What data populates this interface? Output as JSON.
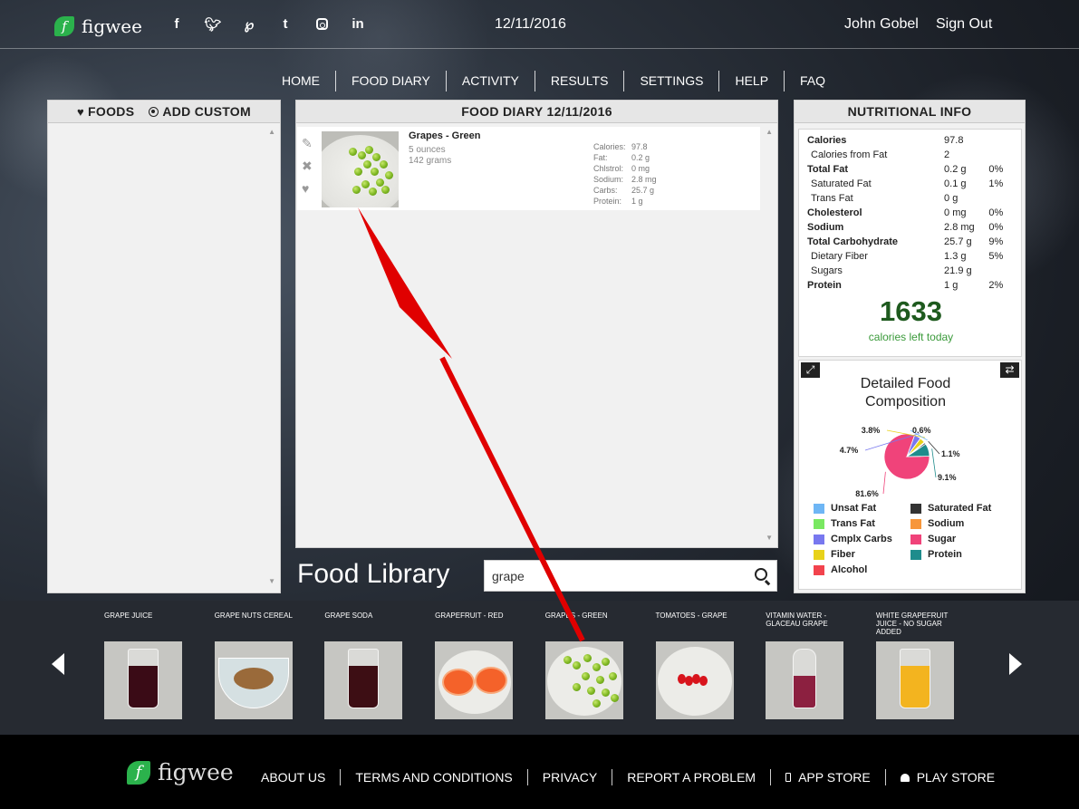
{
  "header": {
    "brand": "figwee",
    "date": "12/11/2016",
    "user_name": "John Gobel",
    "sign_out": "Sign Out",
    "social_icons": [
      "facebook-icon",
      "twitter-icon",
      "pinterest-icon",
      "tumblr-icon",
      "instagram-icon",
      "linkedin-icon"
    ]
  },
  "nav": [
    "HOME",
    "FOOD DIARY",
    "ACTIVITY",
    "RESULTS",
    "SETTINGS",
    "HELP",
    "FAQ"
  ],
  "foods_panel": {
    "tab_foods": "FOODS",
    "tab_custom": "ADD CUSTOM"
  },
  "diary": {
    "title": "FOOD DIARY 12/11/2016",
    "entry": {
      "name": "Grapes - Green",
      "qty_oz": "5 ounces",
      "qty_g": "142 grams",
      "nutrients": [
        {
          "k": "Calories:",
          "v": "97.8"
        },
        {
          "k": "Fat:",
          "v": "0.2 g"
        },
        {
          "k": "Chlstrol:",
          "v": "0 mg"
        },
        {
          "k": "Sodium:",
          "v": "2.8 mg"
        },
        {
          "k": "Carbs:",
          "v": "25.7 g"
        },
        {
          "k": "Protein:",
          "v": "1 g"
        }
      ]
    }
  },
  "nutrition": {
    "title": "NUTRITIONAL INFO",
    "rows": [
      {
        "label": "Calories",
        "amount": "97.8",
        "pct": "",
        "style": "bold"
      },
      {
        "label": "Calories from Fat",
        "amount": "2",
        "pct": "",
        "style": "sub"
      },
      {
        "label": "Total Fat",
        "amount": "0.2 g",
        "pct": "0%",
        "style": "bold"
      },
      {
        "label": "Saturated Fat",
        "amount": "0.1 g",
        "pct": "1%",
        "style": "sub"
      },
      {
        "label": "Trans Fat",
        "amount": "0 g",
        "pct": "",
        "style": "sub"
      },
      {
        "label": "Cholesterol",
        "amount": "0 mg",
        "pct": "0%",
        "style": "bold"
      },
      {
        "label": "Sodium",
        "amount": "2.8 mg",
        "pct": "0%",
        "style": "bold"
      },
      {
        "label": "Total Carbohydrate",
        "amount": "25.7 g",
        "pct": "9%",
        "style": "bold"
      },
      {
        "label": "Dietary Fiber",
        "amount": "1.3 g",
        "pct": "5%",
        "style": "sub"
      },
      {
        "label": "Sugars",
        "amount": "21.9 g",
        "pct": "",
        "style": "sub"
      },
      {
        "label": "Protein",
        "amount": "1 g",
        "pct": "2%",
        "style": "bold"
      }
    ],
    "calories_left": "1633",
    "calories_left_label": "calories left today"
  },
  "composition": {
    "title_line1": "Detailed Food",
    "title_line2": "Composition",
    "legend": [
      {
        "name": "Unsat Fat",
        "color": "#6eb6f5"
      },
      {
        "name": "Saturated Fat",
        "color": "#333333"
      },
      {
        "name": "Trans Fat",
        "color": "#79e861"
      },
      {
        "name": "Sodium",
        "color": "#f7963a"
      },
      {
        "name": "Cmplx Carbs",
        "color": "#7878ef"
      },
      {
        "name": "Sugar",
        "color": "#f0437a"
      },
      {
        "name": "Fiber",
        "color": "#e8d21a"
      },
      {
        "name": "Protein",
        "color": "#1e8c8c"
      },
      {
        "name": "Alcohol",
        "color": "#f2434d"
      }
    ]
  },
  "chart_data": {
    "type": "pie",
    "title": "Detailed Food Composition",
    "slices": [
      {
        "name": "Sugar",
        "value": 81.6,
        "label": "81.6%",
        "color": "#f0437a"
      },
      {
        "name": "Cmplx Carbs",
        "value": 4.7,
        "label": "4.7%",
        "color": "#7878ef"
      },
      {
        "name": "Fiber",
        "value": 3.8,
        "label": "3.8%",
        "color": "#e8d21a"
      },
      {
        "name": "Unsat Fat",
        "value": 0.6,
        "label": "0.6%",
        "color": "#6eb6f5"
      },
      {
        "name": "Saturated Fat",
        "value": 1.1,
        "label": "1.1%",
        "color": "#333333"
      },
      {
        "name": "Protein",
        "value": 9.1,
        "label": "9.1%",
        "color": "#1e8c8c"
      }
    ]
  },
  "library": {
    "title": "Food Library",
    "search_value": "grape",
    "items": [
      {
        "name": "GRAPE JUICE",
        "liquid": "#3a0b16",
        "kind": "glass"
      },
      {
        "name": "GRAPE NUTS CEREAL",
        "liquid": "#9a6a3a",
        "kind": "bowl"
      },
      {
        "name": "GRAPE SODA",
        "liquid": "#3d0e14",
        "kind": "glass"
      },
      {
        "name": "GRAPEFRUIT - RED",
        "liquid": "#f4622a",
        "kind": "grapefruit"
      },
      {
        "name": "GRAPES - GREEN",
        "liquid": "#7db620",
        "kind": "grapes"
      },
      {
        "name": "TOMATOES - GRAPE",
        "liquid": "#d8141c",
        "kind": "tomatoes"
      },
      {
        "name": "VITAMIN WATER - GLACEAU GRAPE",
        "liquid": "#8c2040",
        "kind": "bottle"
      },
      {
        "name": "WHITE GRAPEFRUIT JUICE - NO SUGAR ADDED",
        "liquid": "#f3b41f",
        "kind": "glass"
      }
    ]
  },
  "footer": {
    "brand": "figwee",
    "links": [
      "ABOUT US",
      "TERMS AND CONDITIONS",
      "PRIVACY",
      "REPORT A PROBLEM",
      "APP STORE",
      "PLAY STORE"
    ]
  },
  "colors": {
    "accent_green": "#2bb24c",
    "annotation_arrow": "#e00000",
    "calories_green": "#1e5a1e"
  }
}
